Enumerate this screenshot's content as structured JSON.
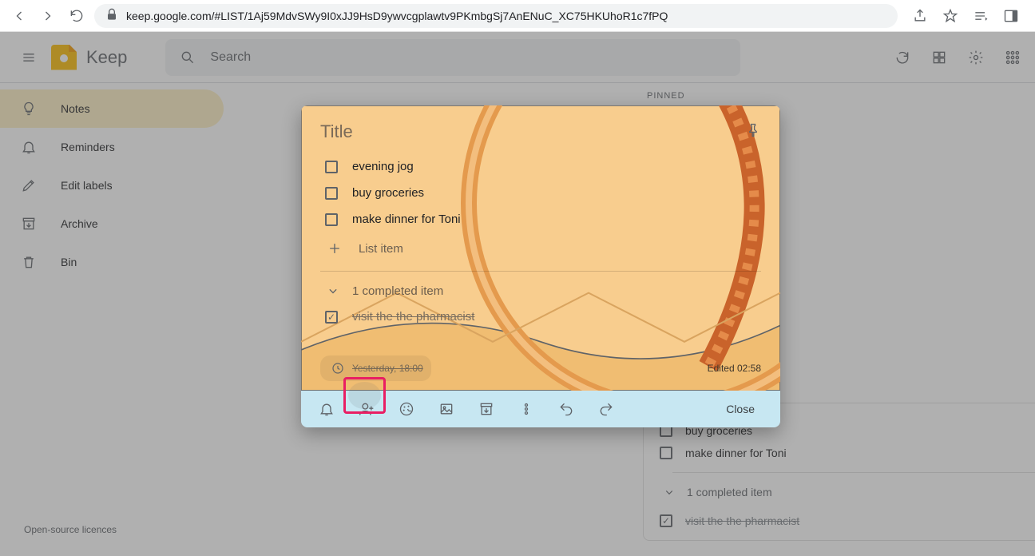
{
  "browser": {
    "url": "keep.google.com/#LIST/1Aj59MdvSWy9I0xJJ9HsD9ywvcgplawtv9PKmbgSj7AnENuC_XC75HKUhoR1c7fPQ"
  },
  "header": {
    "app_name": "Keep",
    "search_placeholder": "Search"
  },
  "sidebar": {
    "items": [
      {
        "label": "Notes",
        "icon": "bulb-icon"
      },
      {
        "label": "Reminders",
        "icon": "bell-icon"
      },
      {
        "label": "Edit labels",
        "icon": "pencil-icon"
      },
      {
        "label": "Archive",
        "icon": "archive-icon"
      },
      {
        "label": "Bin",
        "icon": "bin-icon"
      }
    ]
  },
  "main": {
    "pinned_label": "PINNED"
  },
  "bg_note": {
    "items": [
      {
        "label": "buy groceries",
        "checked": false
      },
      {
        "label": "make dinner for Toni",
        "checked": false
      }
    ],
    "completed_label": "1 completed item",
    "completed_items": [
      {
        "label": "visit the the pharmacist",
        "checked": true
      }
    ]
  },
  "modal": {
    "title_placeholder": "Title",
    "items": [
      {
        "label": "evening jog",
        "checked": false
      },
      {
        "label": "buy groceries",
        "checked": false
      },
      {
        "label": "make dinner for Toni",
        "checked": false
      }
    ],
    "add_placeholder": "List item",
    "completed_label": "1 completed item",
    "completed_items": [
      {
        "label": "visit the the pharmacist",
        "checked": true
      }
    ],
    "reminder_text": "Yesterday, 18:00",
    "edited_text": "Edited 02:58",
    "close_label": "Close"
  },
  "footer": {
    "licence": "Open-source licences"
  }
}
